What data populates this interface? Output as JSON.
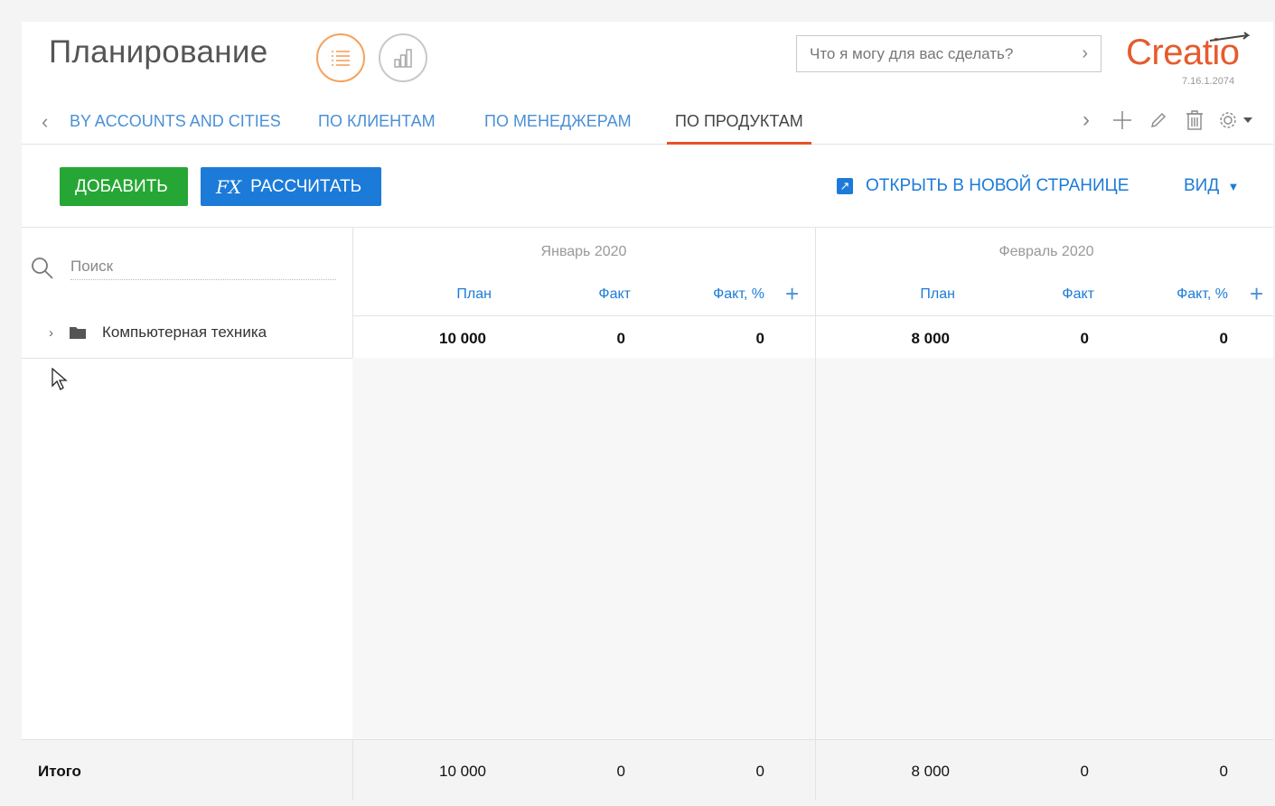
{
  "header": {
    "title": "Планирование",
    "command_placeholder": "Что я могу для вас сделать?",
    "logo": "Creatio",
    "version": "7.16.1.2074",
    "view_icons": [
      "list-icon",
      "chart-icon"
    ]
  },
  "tabs": [
    {
      "label": "BY ACCOUNTS AND CITIES",
      "active": false
    },
    {
      "label": "ПО КЛИЕНТАМ",
      "active": false
    },
    {
      "label": "ПО МЕНЕДЖЕРАМ",
      "active": false
    },
    {
      "label": "ПО ПРОДУКТАМ",
      "active": true
    }
  ],
  "toolbar": {
    "add_label": "ДОБАВИТЬ",
    "calc_label": "РАССЧИТАТЬ",
    "open_new_page_label": "ОТКРЫТЬ В НОВОЙ СТРАНИЦЕ",
    "view_label": "ВИД"
  },
  "grid": {
    "search_placeholder": "Поиск",
    "periods": [
      {
        "name": "Январь 2020",
        "columns": [
          "План",
          "Факт",
          "Факт, %"
        ]
      },
      {
        "name": "Февраль 2020",
        "columns": [
          "План",
          "Факт",
          "Факт, %"
        ]
      }
    ],
    "rows": [
      {
        "name": "Компьютерная техника",
        "values": [
          "10 000",
          "0",
          "0",
          "8 000",
          "0",
          "0"
        ]
      }
    ],
    "total": {
      "label": "Итого",
      "values": [
        "10 000",
        "0",
        "0",
        "8 000",
        "0",
        "0"
      ]
    }
  },
  "colors": {
    "accent": "#1c7bd8",
    "add_button": "#26a735",
    "active_tab": "#e8502c",
    "logo": "#e65b2d"
  }
}
